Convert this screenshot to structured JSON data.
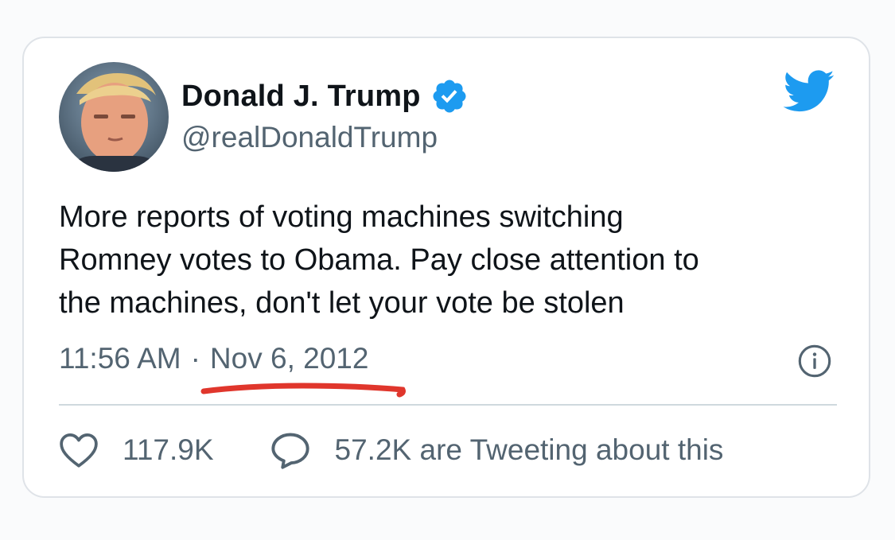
{
  "tweet": {
    "author_name": "Donald J. Trump",
    "handle": "@realDonaldTrump",
    "verified": true,
    "text": "More reports of voting machines switching\nRomney votes to Obama. Pay close attention to\nthe machines, don't let your vote be stolen",
    "time": "11:56 AM",
    "separator": "·",
    "date": "Nov 6, 2012",
    "likes": "117.9K",
    "conversation": "57.2K are Tweeting about this"
  },
  "icons": {
    "avatar": "profile-photo",
    "verified": "verified-badge-icon",
    "brand": "twitter-bird-icon",
    "info": "info-icon",
    "like": "heart-icon",
    "reply": "speech-bubble-icon"
  },
  "colors": {
    "accent": "#1d9bf0",
    "text": "#0f1419",
    "secondary": "#536471",
    "highlight_underline": "#e0362c",
    "border": "#dfe3e8"
  }
}
